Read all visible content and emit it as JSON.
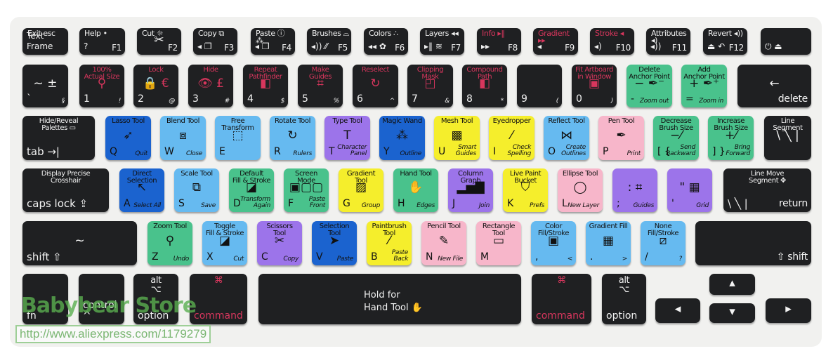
{
  "colors": {
    "black": "#1f2022",
    "dark_blue": "#1b63cf",
    "light_blue": "#66baf0",
    "purple": "#9c74ea",
    "yellow": "#f5ee2c",
    "green": "#49c28c",
    "pink": "#f7b6ca",
    "red_text": "#d8365d",
    "white_text": "#f2f2f2"
  },
  "watermark": {
    "store": "Babybear Store",
    "url": "http://www.aliexpress.com/1179279"
  },
  "rows": [
    {
      "keys": [
        {
          "title": "Exit    esc",
          "main": "Text Frame",
          "color": "black"
        },
        {
          "title": "Help       •",
          "main": "?",
          "sub": "F1",
          "color": "black"
        },
        {
          "title": "Cut        ☼",
          "glyph": "✂",
          "sub": "F2",
          "color": "black"
        },
        {
          "title": "Copy  ⧉",
          "main": "◂ ❐",
          "sub": "F3",
          "color": "black"
        },
        {
          "title": "Paste ⓘ ⁂",
          "main": "◂ ❐",
          "sub": "F4",
          "color": "black"
        },
        {
          "title": "Brushes ⌓",
          "main": "◂)) ⁄⁄",
          "sub": "F5",
          "color": "black"
        },
        {
          "title": "Colors ∴",
          "main": "◂◂ ✿",
          "sub": "F6",
          "color": "black"
        },
        {
          "title": "Layers ◂◂",
          "main": "▸‖ ≋",
          "sub": "F7",
          "color": "black"
        },
        {
          "title": "Info     ▸‖",
          "main": "▸▸",
          "sub": "F8",
          "color": "black",
          "red": true
        },
        {
          "title": "Gradient ▸▸",
          "main": "◂",
          "sub": "F9",
          "color": "black",
          "red": true
        },
        {
          "title": "Stroke   ◂",
          "main": "◂)",
          "sub": "F10",
          "color": "black",
          "red": true
        },
        {
          "title": "Attributes ◂)",
          "main": "◂))",
          "sub": "F11",
          "color": "black"
        },
        {
          "title": "Revert  ◂))",
          "main": "⏏ ↶",
          "sub": "F12",
          "color": "black"
        },
        {
          "main": "⏻   ⏏",
          "color": "black"
        }
      ]
    },
    {
      "keys": [
        {
          "glyph": "~  ±",
          "main": "`",
          "sub": "§",
          "color": "black"
        },
        {
          "title": "100%\nActual Size",
          "glyph": "⚲",
          "main": "1",
          "sub": "!",
          "color": "black",
          "red": true
        },
        {
          "title": "Lock",
          "glyph": "🔒 €",
          "main": "2",
          "sub": "@",
          "color": "black",
          "red": true
        },
        {
          "title": "Hide",
          "glyph": "👁 £",
          "main": "3",
          "sub": "#",
          "color": "black",
          "red": true
        },
        {
          "title": "Repeat\nPathfinder",
          "glyph": "◧",
          "main": "4",
          "sub": "$",
          "color": "black",
          "red": true
        },
        {
          "title": "Make\nGuides",
          "glyph": "⌗",
          "main": "5",
          "sub": "%",
          "color": "black",
          "red": true
        },
        {
          "title": "Reselect",
          "glyph": "↻",
          "main": "6",
          "sub": "^",
          "color": "black",
          "red": true
        },
        {
          "title": "Clipping\nMask",
          "glyph": "◰",
          "main": "7",
          "sub": "&",
          "color": "black",
          "red": true
        },
        {
          "title": "Compound\nPath",
          "glyph": "◧",
          "main": "8",
          "sub": "*",
          "color": "black",
          "red": true
        },
        {
          "main": "9",
          "sub": "(",
          "color": "black"
        },
        {
          "title": "Fit Artboard\nin Window",
          "glyph": "▣",
          "main": "0",
          "sub": ")",
          "color": "black",
          "red": true
        },
        {
          "title": "Delete\nAnchor Point",
          "glyph": "−  ✒⁻",
          "main": "-",
          "sub": "Zoom out",
          "color": "green"
        },
        {
          "title": "Add\nAnchor Point",
          "glyph": "+  ✒⁺",
          "main": "=",
          "sub": "Zoom in",
          "color": "green"
        },
        {
          "glyph": "←",
          "main": "",
          "sub": "delete",
          "color": "black",
          "big": true
        }
      ]
    },
    {
      "keys": [
        {
          "title": "Hide/Reveal\nPalettes ▭",
          "main": "tab →|",
          "color": "black",
          "big": true
        },
        {
          "title": "Lasso Tool",
          "glyph": "➶",
          "main": "Q",
          "sub": "Quit",
          "color": "dark_blue"
        },
        {
          "title": "Blend Tool",
          "glyph": "⧈",
          "main": "W",
          "sub": "Close",
          "color": "light_blue"
        },
        {
          "title": "Free\nTransform",
          "glyph": "⬚",
          "main": "E",
          "color": "light_blue"
        },
        {
          "title": "Rotate Tool",
          "glyph": "↻",
          "main": "R",
          "sub": "Rulers",
          "color": "light_blue"
        },
        {
          "title": "Type Tool",
          "glyph": "T",
          "main": "T",
          "sub": "Character\nPanel",
          "color": "purple"
        },
        {
          "title": "Magic Wand",
          "glyph": "⁂",
          "main": "Y",
          "sub": "Outline",
          "color": "dark_blue"
        },
        {
          "title": "Mesh Tool",
          "glyph": "▩",
          "main": "U",
          "sub": "Smart\nGuides",
          "color": "yellow"
        },
        {
          "title": "Eyedropper",
          "glyph": "⁄",
          "main": "I",
          "sub": "Check\nSpelling",
          "color": "yellow"
        },
        {
          "title": "Reflect Tool",
          "glyph": "⋈",
          "main": "O",
          "sub": "Create\nOutlines",
          "color": "light_blue"
        },
        {
          "title": "Pen Tool",
          "glyph": "✒",
          "main": "P",
          "sub": "Print",
          "color": "pink"
        },
        {
          "title": "Decrease\nBrush Size",
          "glyph": "−⁄",
          "main": "[ {",
          "sub": "Send\nBackward",
          "color": "green"
        },
        {
          "title": "Increase\nBrush Size",
          "glyph": "+⁄",
          "main": "] }",
          "sub": "Bring\nForward",
          "color": "green"
        },
        {
          "title": "Line\nSegment",
          "glyph": "\\ ╲ |",
          "color": "black"
        }
      ]
    },
    {
      "keys": [
        {
          "title": "Display Precise\nCrosshair",
          "main": "caps lock ⇪",
          "color": "black",
          "big": true
        },
        {
          "title": "Direct\nSelection",
          "glyph": "↖",
          "main": "A",
          "sub": "Select All",
          "color": "dark_blue"
        },
        {
          "title": "Scale Tool",
          "glyph": "⧉",
          "main": "S",
          "sub": "Save",
          "color": "light_blue"
        },
        {
          "title": "Default\nFill & Stroke",
          "glyph": "◪",
          "main": "D",
          "sub": "Transform\nAgain",
          "color": "green"
        },
        {
          "title": "Screen Mode",
          "glyph": "▣▢▢",
          "main": "F",
          "sub": "Paste\nFront",
          "color": "green"
        },
        {
          "title": "Gradient Tool",
          "glyph": "▨",
          "main": "G",
          "sub": "Group",
          "color": "yellow"
        },
        {
          "title": "Hand Tool",
          "glyph": "✋",
          "main": "H",
          "sub": "Edges",
          "color": "green"
        },
        {
          "title": "Column\nGraph",
          "glyph": "▂▅▇",
          "main": "J",
          "sub": "Join",
          "color": "purple"
        },
        {
          "title": "Live Paint\nBucket",
          "glyph": "⛉",
          "main": "K",
          "sub": "Prefs",
          "color": "yellow"
        },
        {
          "title": "Ellipse Tool",
          "glyph": "◯",
          "main": "L",
          "sub": "New Layer",
          "color": "pink"
        },
        {
          "glyph": ":  ⌗",
          "main": ";",
          "sub": "Guides",
          "color": "purple"
        },
        {
          "glyph": "\"  ▦",
          "main": "'",
          "sub": "Grid",
          "color": "purple"
        },
        {
          "title": "Line          Move\nSegment         ✥",
          "main": "\\ ╲ |",
          "sub": "return",
          "color": "black",
          "big": true
        }
      ]
    },
    {
      "keys": [
        {
          "glyph": "               ~",
          "main": "shift ⇧",
          "color": "black",
          "big": true
        },
        {
          "title": "Zoom Tool",
          "glyph": "⚲",
          "main": "Z",
          "sub": "Undo",
          "color": "green"
        },
        {
          "title": "Toggle\nFill & Stroke",
          "glyph": "◪",
          "main": "X",
          "sub": "Cut",
          "color": "light_blue"
        },
        {
          "title": "Scissors\nTool",
          "glyph": "✂",
          "main": "C",
          "sub": "Copy",
          "color": "purple"
        },
        {
          "title": "Selection\nTool",
          "glyph": "➤",
          "main": "V",
          "sub": "Paste",
          "color": "dark_blue"
        },
        {
          "title": "Paintbrush\nTool",
          "glyph": "⁄",
          "main": "B",
          "sub": "Paste\nBack",
          "color": "yellow"
        },
        {
          "title": "Pencil Tool",
          "glyph": "✎",
          "main": "N",
          "sub": "New File",
          "color": "pink"
        },
        {
          "title": "Rectangle\nTool",
          "glyph": "▭",
          "main": "M",
          "color": "pink"
        },
        {
          "title": "Color\nFill/Stroke",
          "glyph": "▣",
          "main": ",",
          "sub": "<",
          "color": "light_blue"
        },
        {
          "title": "Gradient Fill",
          "glyph": "▦",
          "main": ".",
          "sub": ">",
          "color": "light_blue"
        },
        {
          "title": "None\nFill/Stroke",
          "glyph": "⧄",
          "main": "/",
          "sub": "?",
          "color": "light_blue"
        },
        {
          "sub": "⇧ shift",
          "color": "black",
          "big": true
        }
      ]
    },
    {
      "keys": [
        {
          "main": "fn",
          "color": "black"
        },
        {
          "main": "control ^",
          "color": "black"
        },
        {
          "title": "alt\n⌥",
          "main": "option",
          "color": "black"
        },
        {
          "title": "⌘",
          "main": "command",
          "color": "black",
          "red": true
        },
        {
          "glyph": "Hold for\nHand Tool ✋",
          "color": "black"
        },
        {
          "title": "⌘",
          "main": "command",
          "color": "black",
          "red": true
        },
        {
          "title": "alt\n⌥",
          "main": "option",
          "color": "black"
        },
        {
          "glyph": "◂",
          "color": "black"
        },
        {
          "glyph": "▴",
          "color": "black"
        },
        {
          "glyph": "▾",
          "color": "black"
        },
        {
          "glyph": "▸",
          "color": "black"
        }
      ]
    }
  ]
}
